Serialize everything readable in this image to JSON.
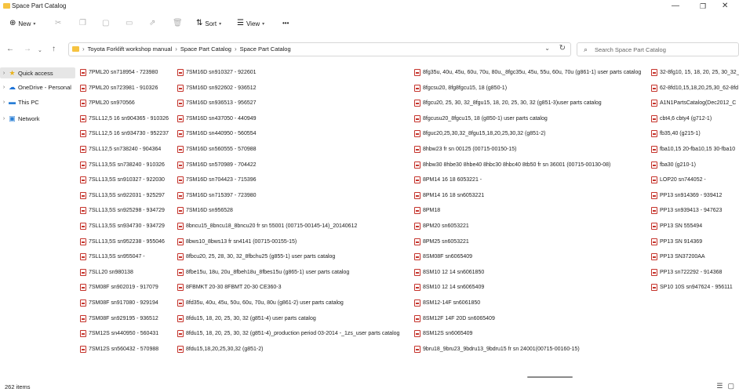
{
  "window": {
    "title": "Space Part Catalog",
    "minimize": "—",
    "maximize": "❐",
    "close": "✕"
  },
  "toolbar": {
    "new_label": "New",
    "sort_label": "Sort",
    "view_label": "View",
    "more": "•••"
  },
  "address": {
    "segments": [
      "Toyota Forklift workshop manual",
      "Space Part Catalog",
      "Space Part Catalog"
    ],
    "separator": "›",
    "search_placeholder": "Search Space Part Catalog"
  },
  "sidebar": {
    "items": [
      {
        "label": "Quick access",
        "icon": "star-icon"
      },
      {
        "label": "OneDrive - Personal",
        "icon": "cloud-icon"
      },
      {
        "label": "This PC",
        "icon": "pc-icon"
      },
      {
        "label": "Network",
        "icon": "network-icon"
      }
    ]
  },
  "files": {
    "col1": [
      "7PML20 sn718954 - 723980",
      "7PML20 sn723981 - 910326",
      "7PML20 sn970566",
      "7SLL12,5  16  sn904365 - 910326",
      "7SLL12,5  16  sn934730 - 952237",
      "7SLL12,5  sn738240 - 904364",
      "7SLL13,5S  sn738240 - 910326",
      "7SLL13,5S  sn910327 - 922030",
      "7SLL13,5S  sn922031 - 925297",
      "7SLL13,5S  sn925298 - 934729",
      "7SLL13,5S  sn934730 - 934729",
      "7SLL13,5S  sn952238 - 955046",
      "7SLL13,5S  sn955047 -",
      "7SLL20 sn980138",
      "7SM08F  sn902019 - 917079",
      "7SM08F  sn917080 - 929194",
      "7SM08F  sn929195 - 936512",
      "7SM12S  sn440950 - 560431",
      "7SM12S  sn560432 - 570988"
    ],
    "col2": [
      "7SM16D  sn910327 - 922601",
      "7SM16D  sn922602 - 936512",
      "7SM16D  sn936513 - 956527",
      "7SM16D  sn437050 - 440949",
      "7SM16D  sn440950 - 560554",
      "7SM16D  sn560555 - 570988",
      "7SM16D  sn570989 - 704422",
      "7SM16D  sn704423 - 715396",
      "7SM16D  sn715397 - 723980",
      "7SM16D  sn956528",
      "8bncu15_8bncu18_8bncu20 fr sn 55001 (00715-00145-14)_20140612",
      "8bws10_8bws13 fr sn4141 (00715-00155-15)",
      "8fbcu20, 25, 28, 30, 32_8fbchu25 (g855-1) user parts catalog",
      "8fbe15u, 18u, 20u_8fbeh18u_8fbes15u (g865-1) user parts catalog",
      "8FBMKT 20-30 8FBMT 20-30 CE360-3",
      "8fd35u, 40u, 45u, 50u, 60u, 70u, 80u (g861-2) user parts catalog",
      "8fdu15, 18, 20, 25, 30, 32 (g851-4) user parts catalog",
      "8fdu15, 18, 20, 25, 30, 32 (g851-4)_production period 03-2014 -_1zs_user parts catalog",
      "8fdu15,18,20,25,30,32 (g851-2)"
    ],
    "col3": [
      "8fg35u, 40u, 45u, 60u, 70u, 80u,_8fgc35u, 45u, 55u, 60u, 70u (g861-1) user parts catalog",
      "8fgcsu20, 8fg8fgcu15, 18 (g850-1)",
      "8fgcu20, 25, 30, 32_8fgu15, 18, 20, 25, 30, 32 (g851-3)user parts catalog",
      "8fgcusu20_8fgcu15, 18 (g850-1) user parts catalog",
      "8fguc20,25,30,32_8fgu15,18,20,25,30,32 (g851-2)",
      "8hbw23 fr sn 00125 (00715-00150-15)",
      "8hbw30 8hbe30 8hbe40 8hbc30 8hbc40 8tb50 fr sn 36001 (00715-00130-08)",
      "8PM14 16 18 6053221 -",
      "8PM14 16 18 sn6053221",
      "8PM18",
      "8PM20 sn6053221",
      "8PM25 sn6053221",
      "8SM08F  sn6065409",
      "8SM10 12 14  sn6061850",
      "8SM10 12 14  sn6065409",
      "8SM12-14F sn6061850",
      "8SM12F 14F 20D  sn6065409",
      "8SM12S sn6065409",
      "9bru18_9bru23_9bdru13_9bdru15 fr sn 24001(00715-00160-15)"
    ],
    "col4": [
      "32-8fg10, 15, 18, 20, 25, 30_32_",
      "62-8fd10,15,18,20,25,30_62-8fd",
      "A1N1PartsCatalog(Dec2012_C",
      "cbt4,6 cbty4 (g712-1)",
      "fb35,40 (g215-1)",
      "fba10,15 20-fba10,15 30-fba10",
      "fba30 (g210-1)",
      "LOP20  sn744052 -",
      "PP13  sn914369 - 939412",
      "PP13  sn939413 - 947623",
      "PP13 SN 555494",
      "PP13 SN 914369",
      "PP13 SN37200AA",
      "PP13  sn722292 - 914368",
      "SP10 10S  sn947624 - 956111"
    ]
  },
  "status": {
    "item_count": "262 items"
  }
}
